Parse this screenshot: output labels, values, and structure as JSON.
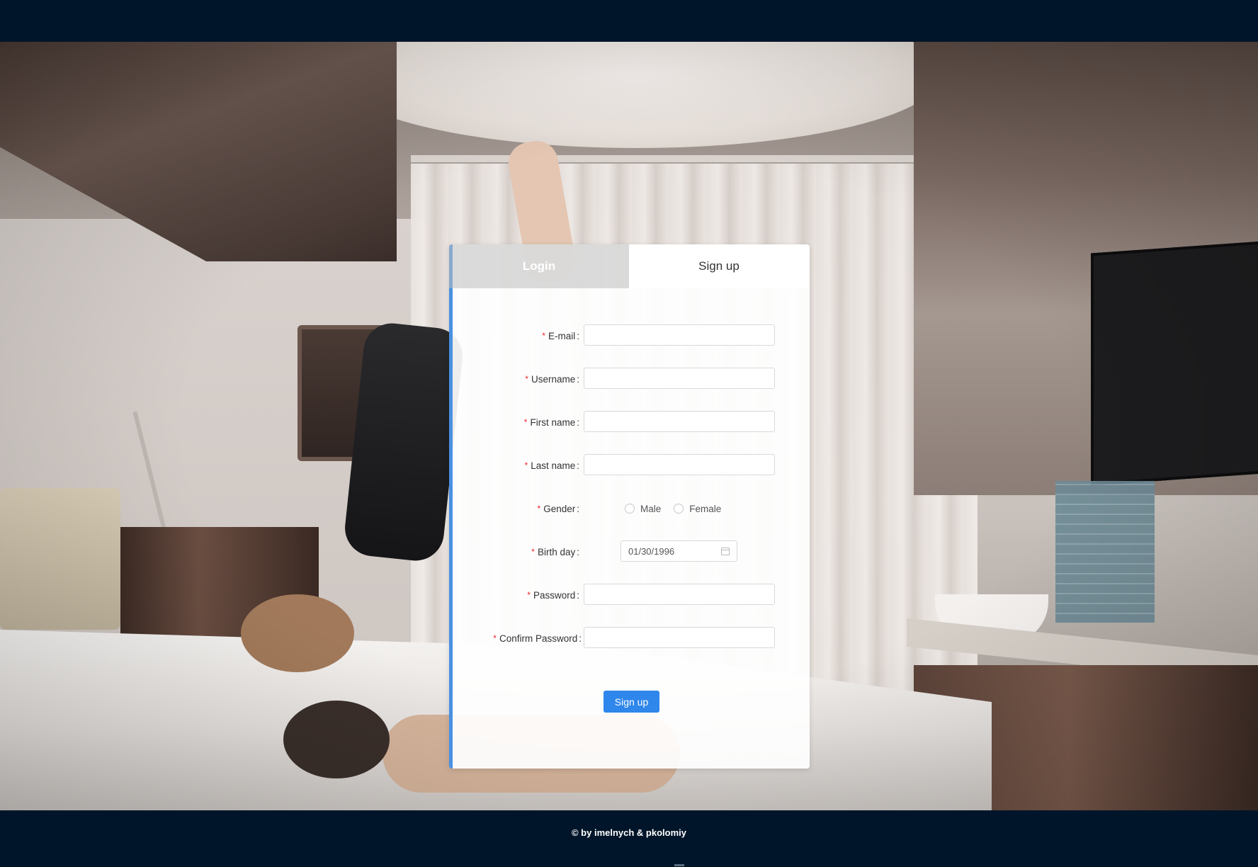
{
  "tabs": {
    "login_label": "Login",
    "signup_label": "Sign up",
    "active": "signup"
  },
  "form": {
    "fields": {
      "email": {
        "label": "E-mail",
        "value": "",
        "placeholder": ""
      },
      "username": {
        "label": "Username",
        "value": "",
        "placeholder": ""
      },
      "first_name": {
        "label": "First name",
        "value": "",
        "placeholder": ""
      },
      "last_name": {
        "label": "Last name",
        "value": "",
        "placeholder": ""
      },
      "gender": {
        "label": "Gender",
        "options": [
          "Male",
          "Female"
        ],
        "selected": ""
      },
      "birthday": {
        "label": "Birth day",
        "value": "01/30/1996"
      },
      "password": {
        "label": "Password",
        "value": ""
      },
      "confirm_password": {
        "label": "Confirm Password",
        "value": ""
      }
    },
    "required_mark": "*",
    "colon": ":",
    "submit_label": "Sign up"
  },
  "footer": {
    "text": "© by imelnych & pkolomiy"
  },
  "colors": {
    "nav_bg": "#001529",
    "primary": "#2f86eb",
    "accent_bar": "#4a90e2",
    "required": "#f5222d"
  },
  "icons": {
    "date_picker": "calendar-icon"
  }
}
